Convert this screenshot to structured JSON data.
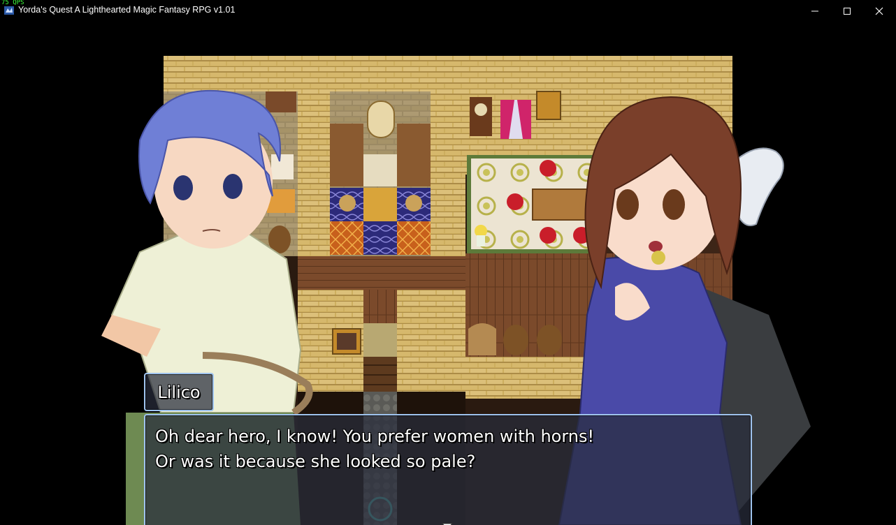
{
  "window": {
    "fps": "75 QPS",
    "title": "Yorda's Quest A Lighthearted Magic Fantasy RPG v1.01",
    "icon": "app-icon"
  },
  "dialogue": {
    "speaker": "Lilico",
    "lines": [
      "Oh dear hero, I know! You prefer women with horns!",
      "Or was it because she looked so pale?"
    ],
    "continue_icon": "triangle-down-icon"
  },
  "colors": {
    "window_border": "#9fc3ee",
    "window_bg": "#282c3c",
    "wall": "#c9a95a",
    "floor": "#7a4a2a",
    "hero_hair": "#6f7fd6",
    "girl_hair": "#7a3f2a",
    "girl_dress": "#4a4aa8"
  }
}
